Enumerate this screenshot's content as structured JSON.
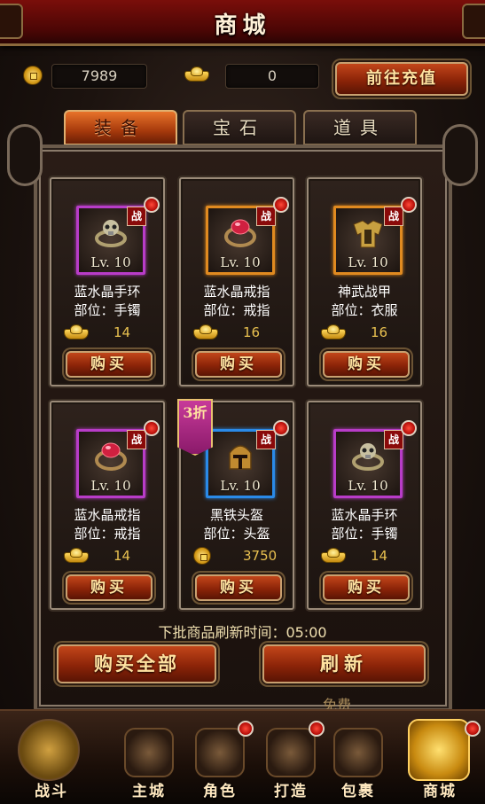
{
  "header": {
    "title": "商城"
  },
  "currency": {
    "coins": "7989",
    "ingots": "0",
    "recharge_label": "前往充值"
  },
  "tabs": [
    {
      "label": "装备",
      "active": true
    },
    {
      "label": "宝石",
      "active": false
    },
    {
      "label": "道具",
      "active": false
    }
  ],
  "items": [
    {
      "name": "蓝水晶手环",
      "slot": "部位：手镯",
      "level": "Lv. 10",
      "tag": "战",
      "price": "14",
      "currency": "ingot-icon",
      "quality": "purple",
      "art": "skull-ring",
      "buy_label": "购买"
    },
    {
      "name": "蓝水晶戒指",
      "slot": "部位：戒指",
      "level": "Lv. 10",
      "tag": "战",
      "price": "16",
      "currency": "ingot-icon",
      "quality": "orange",
      "art": "ruby-ring",
      "buy_label": "购买"
    },
    {
      "name": "神武战甲",
      "slot": "部位：衣服",
      "level": "Lv. 10",
      "tag": "战",
      "price": "16",
      "currency": "ingot-icon",
      "quality": "orange",
      "art": "armor",
      "buy_label": "购买"
    },
    {
      "name": "蓝水晶戒指",
      "slot": "部位：戒指",
      "level": "Lv. 10",
      "tag": "战",
      "price": "14",
      "currency": "ingot-icon",
      "quality": "purple",
      "art": "ruby-ring",
      "buy_label": "购买"
    },
    {
      "name": "黑铁头盔",
      "slot": "部位：头盔",
      "level": "Lv. 10",
      "tag": "战",
      "price": "3750",
      "currency": "coin-icon",
      "quality": "blue",
      "art": "helmet",
      "buy_label": "购买",
      "discount": "3折"
    },
    {
      "name": "蓝水晶手环",
      "slot": "部位：手镯",
      "level": "Lv. 10",
      "tag": "战",
      "price": "14",
      "currency": "ingot-icon",
      "quality": "purple",
      "art": "skull-ring",
      "buy_label": "购买"
    }
  ],
  "refresh": {
    "info": "下批商品刷新时间：05:00",
    "buy_all_label": "购买全部",
    "refresh_label": "刷新",
    "cost_label": "免费"
  },
  "nav": [
    {
      "label": "战斗",
      "icon": "crossed-axes-icon",
      "badge": false
    },
    {
      "label": "主城",
      "icon": "city-icon",
      "badge": false
    },
    {
      "label": "角色",
      "icon": "warrior-icon",
      "badge": true
    },
    {
      "label": "打造",
      "icon": "anvil-icon",
      "badge": true
    },
    {
      "label": "包裹",
      "icon": "bag-icon",
      "badge": false
    },
    {
      "label": "商城",
      "icon": "shop-icon",
      "badge": true,
      "active": true
    }
  ]
}
